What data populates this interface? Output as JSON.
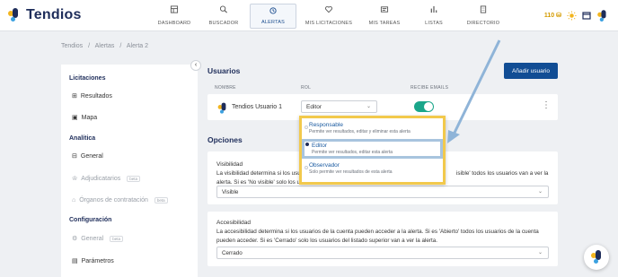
{
  "app": {
    "name": "Tendios"
  },
  "nav": {
    "items": [
      {
        "label": "DASHBOARD",
        "icon": "dashboard-icon"
      },
      {
        "label": "BUSCADOR",
        "icon": "search-icon"
      },
      {
        "label": "ALERTAS",
        "icon": "alarm-clock-icon",
        "active": true
      },
      {
        "label": "MIS LICITACIONES",
        "icon": "heart-icon"
      },
      {
        "label": "MIS TAREAS",
        "icon": "tasks-icon"
      },
      {
        "label": "LISTAS",
        "icon": "bar-chart-icon"
      },
      {
        "label": "DIRECTORIO",
        "icon": "building-icon"
      }
    ],
    "credits": "110"
  },
  "breadcrumb": [
    "Tendios",
    "/",
    "Alertas",
    "/",
    "Alerta 2"
  ],
  "sidebar": {
    "licitaciones_title": "Licitaciones",
    "resultados": "Resultados",
    "mapa": "Mapa",
    "analitica_title": "Analítica",
    "general": "General",
    "adjudicatarios": "Adjudicatarios",
    "organos": "Órganos de contratación",
    "configuracion_title": "Configuración",
    "config_general": "General",
    "parametros": "Parámetros",
    "beta": "beta"
  },
  "usuarios": {
    "title": "Usuarios",
    "add_button": "Añadir usuario",
    "col_nombre": "NOMBRE",
    "col_rol": "ROL",
    "col_emails": "RECIBE EMAILS",
    "row": {
      "name": "Tendios Usuario 1",
      "role": "Editor",
      "receive_emails": true
    }
  },
  "role_options": [
    {
      "title": "Responsable",
      "desc": "Permite ver resultados, editar y eliminar esta alerta",
      "selected": false
    },
    {
      "title": "Editor",
      "desc": "Permite ver resultados, editar esta alerta",
      "selected": true
    },
    {
      "title": "Observador",
      "desc": "Solo permite ver resultados de esta alerta",
      "selected": false
    }
  ],
  "opciones": {
    "title": "Opciones",
    "visibilidad": {
      "title": "Visibilidad",
      "desc_left": "La visibilidad determina si los usua",
      "desc_right": "isible' todos los usuarios van a ver la",
      "desc_line2_left": "alerta. Si es 'No visible' solo los us",
      "value": "Visible"
    },
    "accesibilidad": {
      "title": "Accesibilidad",
      "desc": "La accesibilidad determina si los usuarios de la cuenta pueden acceder a la alerta. Si es 'Abierto' todos los usuarios de la cuenta pueden acceder. Si es 'Cerrado' solo los usuarios del listado superior van a ver la alerta.",
      "value": "Cerrado"
    }
  },
  "colors": {
    "primary": "#114d94",
    "navy": "#1e2d5a",
    "toggle": "#1aa68a",
    "highlight": "#f2c94c",
    "arrow": "#8fb4d8"
  }
}
